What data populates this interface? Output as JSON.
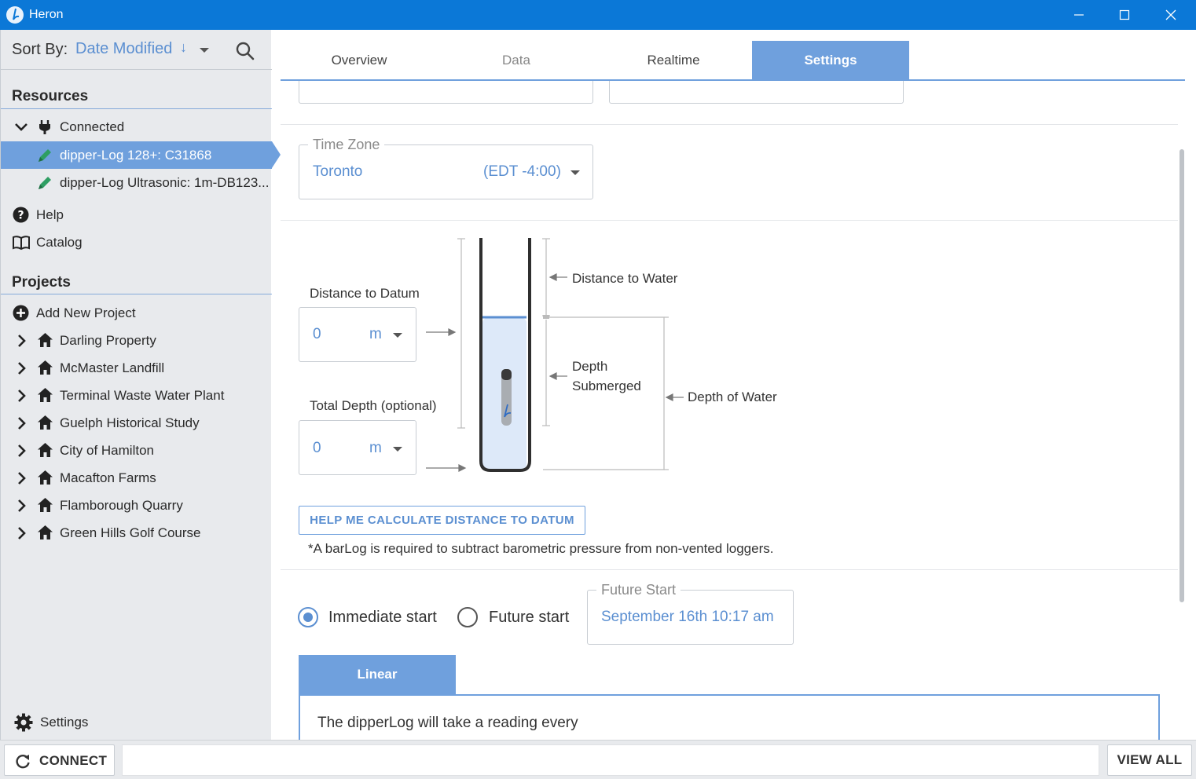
{
  "window": {
    "title": "Heron"
  },
  "sidebar": {
    "sort_label": "Sort By:",
    "sort_value": "Date Modified",
    "sort_direction_glyph": "↓",
    "resources_title": "Resources",
    "connected_label": "Connected",
    "devices": [
      {
        "label": "dipper-Log 128+: C31868",
        "selected": true
      },
      {
        "label": "dipper-Log Ultrasonic: 1m-DB123...",
        "selected": false
      }
    ],
    "help_label": "Help",
    "catalog_label": "Catalog",
    "projects_title": "Projects",
    "add_project_label": "Add New Project",
    "projects": [
      "Darling Property",
      "McMaster Landfill",
      "Terminal Waste Water Plant",
      "Guelph Historical Study",
      "City of Hamilton",
      "Macafton Farms",
      "Flamborough Quarry",
      "Green Hills Golf Course"
    ],
    "settings_label": "Settings"
  },
  "tabs": [
    {
      "label": "Overview",
      "state": "normal"
    },
    {
      "label": "Data",
      "state": "muted"
    },
    {
      "label": "Realtime",
      "state": "normal"
    },
    {
      "label": "Settings",
      "state": "active"
    }
  ],
  "settings": {
    "time_zone": {
      "legend": "Time Zone",
      "city": "Toronto",
      "offset": "(EDT -4:00)"
    },
    "distance_to_datum": {
      "label": "Distance to Datum",
      "value": "0",
      "unit": "m"
    },
    "total_depth": {
      "label": "Total Depth (optional)",
      "value": "0",
      "unit": "m"
    },
    "diagram": {
      "distance_to_water": "Distance to Water",
      "depth_submerged_line1": "Depth",
      "depth_submerged_line2": "Submerged",
      "depth_of_water": "Depth of Water"
    },
    "help_button": "HELP ME CALCULATE DISTANCE TO DATUM",
    "note": "*A barLog is required to subtract barometric pressure from non-vented loggers.",
    "start": {
      "immediate_label": "Immediate start",
      "future_label": "Future start",
      "selected": "immediate",
      "future_legend": "Future Start",
      "future_value": "September 16th 10:17 am"
    },
    "schedule": {
      "tab_label": "Linear",
      "text": "The dipperLog will take a reading every"
    }
  },
  "bottombar": {
    "connect_label": "CONNECT",
    "view_all_label": "VIEW ALL"
  },
  "colors": {
    "titlebar": "#0b78d7",
    "accent": "#6fa0dd",
    "accent_text": "#5b8fd1",
    "sidebar_bg": "#e8eaed"
  }
}
